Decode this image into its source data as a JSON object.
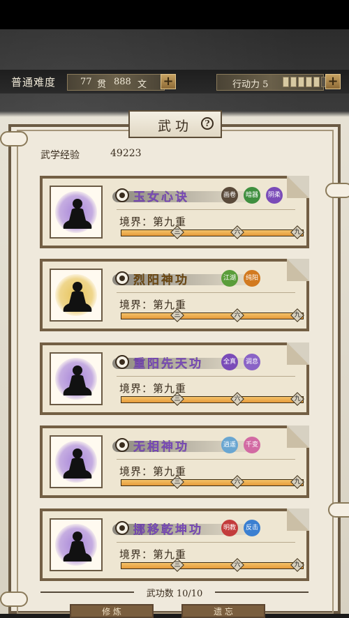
{
  "status_bar": {
    "difficulty": "普通难度",
    "money_guan": "77",
    "money_guan_unit": "贯",
    "money_wen": "888",
    "money_wen_unit": "文",
    "action_label": "行动力 5"
  },
  "panel": {
    "title": "武功",
    "exp_label": "武学经验",
    "exp_value": "49223",
    "count_text": "武功数 10/10"
  },
  "cards": [
    {
      "name": "玉女心诀",
      "name_color": "#7a4bb8",
      "portrait_color": "#a886d9",
      "realm": "境界：第九重",
      "progress": 1.0,
      "tags": [
        {
          "label": "画卷",
          "color": "#5a4a3a"
        },
        {
          "label": "暗器",
          "color": "#3f8f3f"
        },
        {
          "label": "阴柔",
          "color": "#7a4bb8"
        }
      ]
    },
    {
      "name": "烈阳神功",
      "name_color": "#6e4a14",
      "portrait_color": "#e7c45b",
      "realm": "境界：第九重",
      "progress": 1.0,
      "tags": [
        {
          "label": "江湖",
          "color": "#5a9d3a"
        },
        {
          "label": "纯阳",
          "color": "#d27a20"
        }
      ]
    },
    {
      "name": "重阳先天功",
      "name_color": "#7a4bb8",
      "portrait_color": "#a886d9",
      "realm": "境界：第九重",
      "progress": 1.0,
      "tags": [
        {
          "label": "全真",
          "color": "#7a4bb8"
        },
        {
          "label": "调息",
          "color": "#8a63c6"
        }
      ]
    },
    {
      "name": "无相神功",
      "name_color": "#7a4bb8",
      "portrait_color": "#a886d9",
      "realm": "境界：第九重",
      "progress": 1.0,
      "tags": [
        {
          "label": "逍遥",
          "color": "#6aa6d1"
        },
        {
          "label": "千变",
          "color": "#d26aa3"
        }
      ]
    },
    {
      "name": "挪移乾坤功",
      "name_color": "#7a4bb8",
      "portrait_color": "#a886d9",
      "realm": "境界：第九重",
      "progress": 1.0,
      "tags": [
        {
          "label": "明教",
          "color": "#c33c3c"
        },
        {
          "label": "反击",
          "color": "#3b7fd1"
        }
      ]
    }
  ],
  "bar_marks": [
    "三",
    "六",
    "九"
  ],
  "bottom_buttons": [
    "修 炼",
    "遗 忘"
  ]
}
